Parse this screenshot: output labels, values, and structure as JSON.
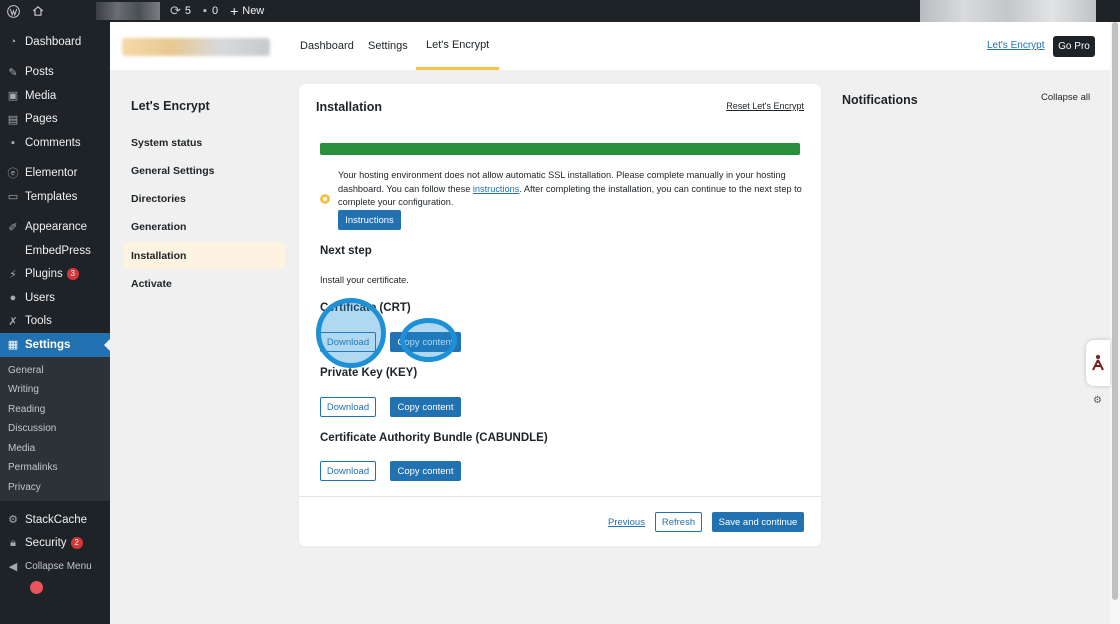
{
  "adminbar": {
    "updates_count": "5",
    "comments_count": "0",
    "new_label": "New"
  },
  "sidebar": {
    "items": [
      {
        "label": "Dashboard",
        "icon": "dashboard-icon"
      },
      {
        "label": "Posts",
        "icon": "pin-icon"
      },
      {
        "label": "Media",
        "icon": "media-icon"
      },
      {
        "label": "Pages",
        "icon": "page-icon"
      },
      {
        "label": "Comments",
        "icon": "comment-icon"
      },
      {
        "label": "Elementor",
        "icon": "elementor-icon"
      },
      {
        "label": "Templates",
        "icon": "folder-icon"
      },
      {
        "label": "Appearance",
        "icon": "brush-icon"
      },
      {
        "label": "EmbedPress",
        "icon": ""
      },
      {
        "label": "Plugins",
        "icon": "plug-icon",
        "badge": "3"
      },
      {
        "label": "Users",
        "icon": "user-icon"
      },
      {
        "label": "Tools",
        "icon": "wrench-icon"
      },
      {
        "label": "Settings",
        "icon": "settings-icon"
      },
      {
        "label": "StackCache",
        "icon": "gear-icon"
      },
      {
        "label": "Security",
        "icon": "lock-icon",
        "badge": "2"
      },
      {
        "label": "Collapse Menu",
        "icon": "collapse-icon"
      }
    ],
    "submenu": [
      "General",
      "Writing",
      "Reading",
      "Discussion",
      "Media",
      "Permalinks",
      "Privacy"
    ]
  },
  "header": {
    "tabs": [
      "Dashboard",
      "Settings",
      "Let's Encrypt"
    ],
    "link_label": "Let's Encrypt",
    "go_pro_label": "Go Pro"
  },
  "le_menu": {
    "title": "Let's Encrypt",
    "items": [
      "System status",
      "General Settings",
      "Directories",
      "Generation",
      "Installation",
      "Activate"
    ],
    "active": "Installation"
  },
  "card": {
    "title": "Installation",
    "reset_label": "Reset Let's Encrypt",
    "progress": 1.0,
    "warning_before": "Your hosting environment does not allow automatic SSL installation. Please complete manually in your hosting dashboard. You can follow these ",
    "warning_link": "instructions",
    "warning_after": ". After completing the installation, you can continue to the next step to complete your configuration.",
    "instructions_button": "Instructions",
    "next_step_title": "Next step",
    "next_step_desc": "Install your certificate.",
    "sections": [
      {
        "title": "Certificate (CRT)",
        "download": "Download",
        "copy": "Copy content"
      },
      {
        "title": "Private Key (KEY)",
        "download": "Download",
        "copy": "Copy content"
      },
      {
        "title": "Certificate Authority Bundle (CABUNDLE)",
        "download": "Download",
        "copy": "Copy content"
      }
    ],
    "footer": {
      "previous": "Previous",
      "refresh": "Refresh",
      "save": "Save and continue"
    }
  },
  "notifications": {
    "title": "Notifications",
    "collapse_all": "Collapse all"
  },
  "colors": {
    "accent": "#2271b1",
    "progress": "#2a8f3a",
    "active_tab": "#f8c344",
    "highlight": "#1e90d6"
  }
}
